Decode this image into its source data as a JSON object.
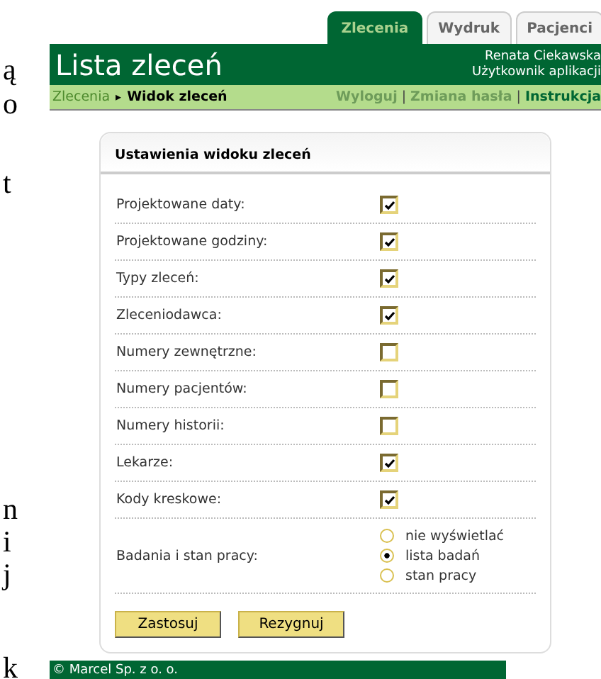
{
  "margin_fragments": [
    "ą",
    "o",
    "t",
    "n",
    "i",
    "j",
    "k"
  ],
  "tabs": [
    {
      "label": "Zlecenia",
      "selected": true
    },
    {
      "label": "Wydruk",
      "selected": false
    },
    {
      "label": "Pacjenci",
      "selected": false
    }
  ],
  "header": {
    "title": "Lista zleceń",
    "user_name": "Renata Ciekawska",
    "user_role": "Użytkownik aplikacji"
  },
  "breadcrumb": {
    "parent": "Zlecenia",
    "separator": "▸",
    "current": "Widok zleceń"
  },
  "links": [
    {
      "label": "Wyloguj",
      "selected": false
    },
    {
      "separator": "|",
      "label": "Zmiana hasła",
      "selected": false
    },
    {
      "separator": "|",
      "label": "Instrukcja",
      "selected": true
    }
  ],
  "settings": {
    "title": "Ustawienia widoku zleceń",
    "rows": [
      {
        "kind": "checkbox",
        "label": "Projektowane daty:",
        "checked": true
      },
      {
        "kind": "checkbox",
        "label": "Projektowane godziny:",
        "checked": true
      },
      {
        "kind": "checkbox",
        "label": "Typy zleceń:",
        "checked": true
      },
      {
        "kind": "checkbox",
        "label": "Zleceniodawca:",
        "checked": true
      },
      {
        "kind": "checkbox",
        "label": "Numery zewnętrzne:",
        "checked": false
      },
      {
        "kind": "checkbox",
        "label": "Numery pacjentów:",
        "checked": false
      },
      {
        "kind": "checkbox",
        "label": "Numery historii:",
        "checked": false
      },
      {
        "kind": "checkbox",
        "label": "Lekarze:",
        "checked": true
      },
      {
        "kind": "checkbox",
        "label": "Kody kreskowe:",
        "checked": true
      },
      {
        "kind": "radio",
        "label": "Badania i stan pracy:",
        "options": [
          {
            "label": "nie wyświetlać",
            "selected": false
          },
          {
            "label": "lista badań",
            "selected": true
          },
          {
            "label": "stan pracy",
            "selected": false
          }
        ]
      }
    ],
    "buttons": [
      "Zastosuj",
      "Rezygnuj"
    ]
  },
  "footer": "© Marcel Sp. z o. o."
}
